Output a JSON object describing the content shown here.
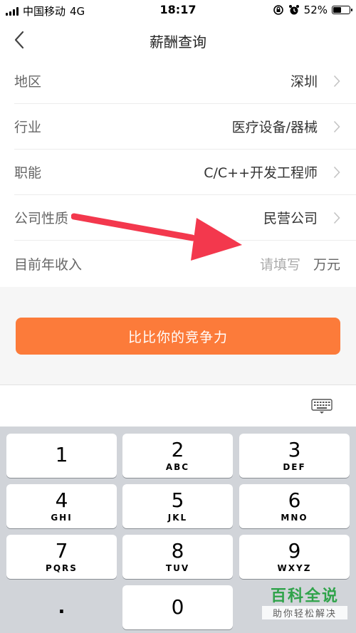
{
  "status_bar": {
    "carrier": "中国移动",
    "network": "4G",
    "time": "18:17",
    "battery": "52%",
    "battery_level": 0.52
  },
  "nav": {
    "title": "薪酬查询",
    "back_icon": "chevron-left-icon"
  },
  "form": {
    "rows": [
      {
        "label": "地区",
        "value": "深圳"
      },
      {
        "label": "行业",
        "value": "医疗设备/器械"
      },
      {
        "label": "职能",
        "value": "C/C++开发工程师"
      },
      {
        "label": "公司性质",
        "value": "民营公司"
      }
    ],
    "income": {
      "label": "目前年收入",
      "placeholder": "请填写",
      "unit": "万元"
    }
  },
  "cta_label": "比比你的竞争力",
  "keyboard": {
    "keys": [
      {
        "num": "1",
        "letters": ""
      },
      {
        "num": "2",
        "letters": "ABC"
      },
      {
        "num": "3",
        "letters": "DEF"
      },
      {
        "num": "4",
        "letters": "GHI"
      },
      {
        "num": "5",
        "letters": "JKL"
      },
      {
        "num": "6",
        "letters": "MNO"
      },
      {
        "num": "7",
        "letters": "PQRS"
      },
      {
        "num": "8",
        "letters": "TUV"
      },
      {
        "num": "9",
        "letters": "WXYZ"
      },
      {
        "num": ".",
        "letters": ""
      },
      {
        "num": "0",
        "letters": ""
      }
    ]
  },
  "watermark": {
    "title": "百科全说",
    "subtitle": "助你轻松解决"
  },
  "colors": {
    "accent": "#fc7b3a",
    "arrow": "#f3384d",
    "watermark": "#2fa34a"
  }
}
